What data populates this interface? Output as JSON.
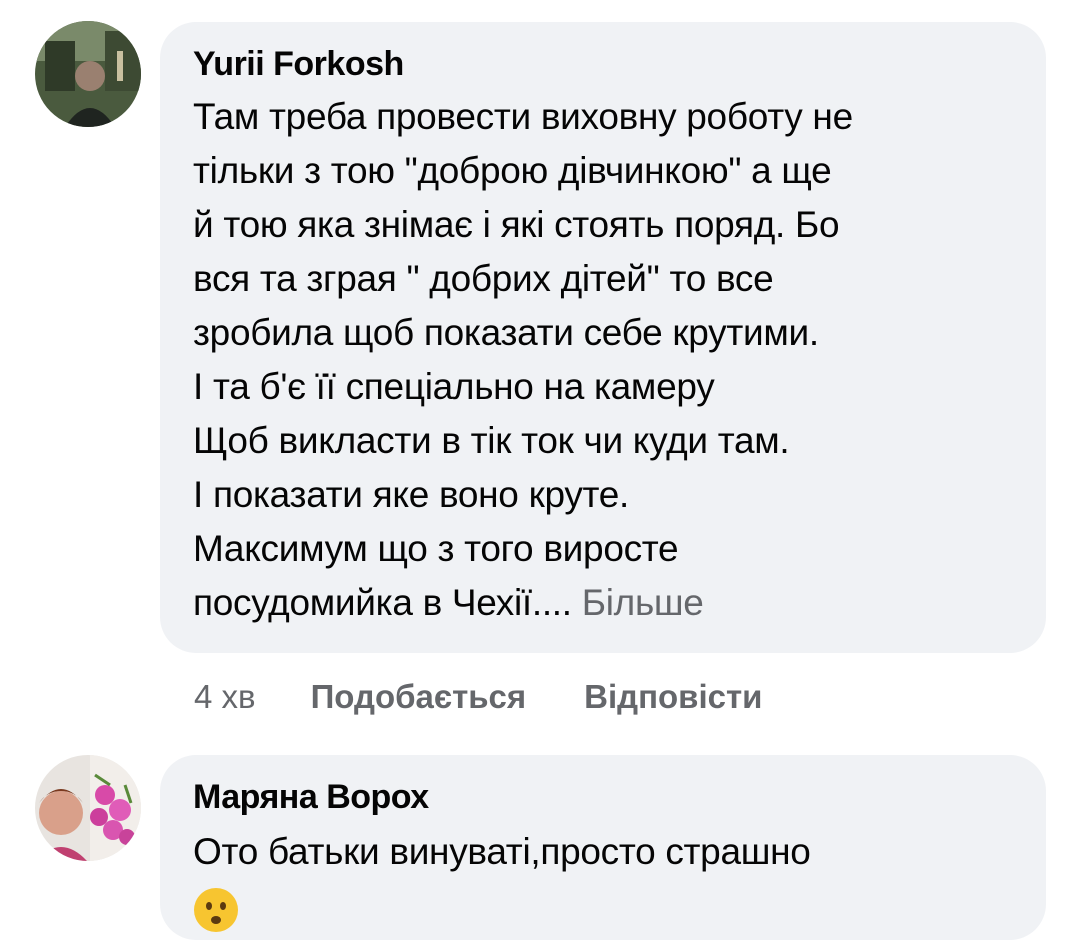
{
  "comments": [
    {
      "author": "Yurii Forkosh",
      "text": "Там треба провести виховну роботу не\nтільки з тою \"доброю дівчинкою\" а ще\nй тою яка знімає і які стоять поряд. Бо\nвся та зграя \" добрих дітей\" то все\nзробила щоб показати себе крутими.\nІ та б'є її спеціально на камеру\nЩоб викласти в тік ток чи куди там.\nІ показати яке воно круте.\nМаксимум що з того виросте\nпосудомийка в Чехії....",
      "more_label": "Більше",
      "time": "4 хв",
      "like_label": "Подобається",
      "reply_label": "Відповісти"
    },
    {
      "author": "Маряна Ворох",
      "text": "Ото батьки винуваті,просто страшно",
      "emoji": "frowning-face-emoji"
    }
  ],
  "colors": {
    "bubble": "#f0f2f5",
    "text": "#050505",
    "secondary": "#65676b",
    "emoji": "#f7c530"
  }
}
